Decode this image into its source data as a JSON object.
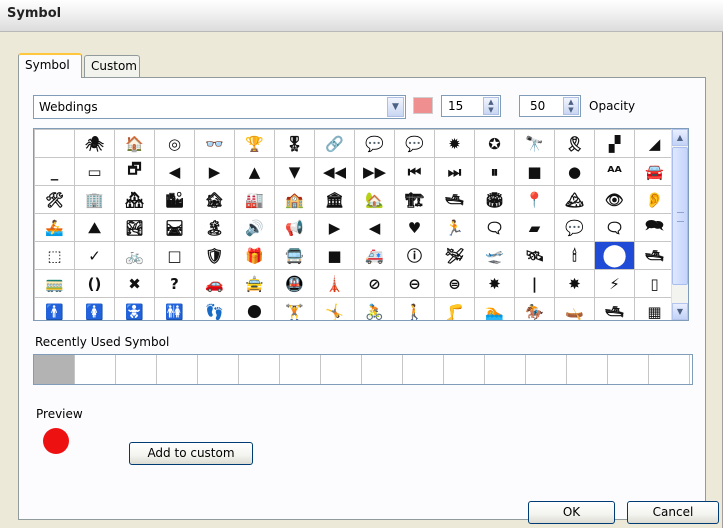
{
  "window": {
    "title": "Symbol"
  },
  "tabs": [
    {
      "label": "Symbol",
      "active": true
    },
    {
      "label": "Custom",
      "active": false
    }
  ],
  "font_select": {
    "value": "Webdings"
  },
  "color": "#f08f8f",
  "size_spinner": {
    "value": "15"
  },
  "opacity_spinner": {
    "value": "50"
  },
  "opacity_label": "Opacity",
  "symbols": [
    [
      "",
      "🕷",
      "🏠",
      "◎",
      "👓",
      "🏆",
      "🎖",
      "🔗",
      "💬",
      "💬",
      "✹",
      "✪",
      "🔭",
      "🎗",
      "▞",
      "◢"
    ],
    [
      "_",
      "▭",
      "🗗",
      "◀",
      "▶",
      "▲",
      "▼",
      "◀◀",
      "▶▶",
      "⏮",
      "⏭",
      "⏸",
      "■",
      "●",
      "ᴬᴬ",
      "🚘"
    ],
    [
      "🛠",
      "🏢",
      "🏘",
      "🏙",
      "🏚",
      "🏭",
      "🏫",
      "🏛",
      "🏡",
      "🏗",
      "🛥",
      "🏟",
      "📍",
      "🏔",
      "👁",
      "👂"
    ],
    [
      "🚣",
      "⛰",
      "🏞",
      "🛤",
      "🏝",
      "🔊",
      "📢",
      "▶",
      "◀",
      "♥",
      "🏃",
      "🗨",
      "▰",
      "💬",
      "🗨",
      "🗪"
    ],
    [
      "⬚",
      "✓",
      "🚲",
      "□",
      "🛡",
      "🎁",
      "🚍",
      "■",
      "🚑",
      "ⓘ",
      "🛩",
      "🛫",
      "🛰",
      "🕯",
      "⬤",
      "🛥"
    ],
    [
      "🚃",
      "()",
      "✖",
      "?",
      "🚗",
      "🚖",
      "🚇",
      "🗼",
      "⊘",
      "⊖",
      "⊜",
      "✸",
      "|",
      "✸",
      "⚡",
      "▯"
    ],
    [
      "🚹",
      "🚺",
      "🚼",
      "🚻",
      "👣",
      "🌑",
      "🏋",
      "🤸",
      "🚴",
      "🚶",
      "🦵",
      "🏊",
      "🏇",
      "🛶",
      "🛥",
      "▦"
    ]
  ],
  "selected_symbol": {
    "row": 4,
    "col": 14
  },
  "recently_used": {
    "label": "Recently Used Symbol",
    "slots": 16
  },
  "preview": {
    "label": "Preview",
    "color": "#ee1111"
  },
  "buttons": {
    "add_to_custom": "Add to custom",
    "ok": "OK",
    "cancel": "Cancel"
  }
}
